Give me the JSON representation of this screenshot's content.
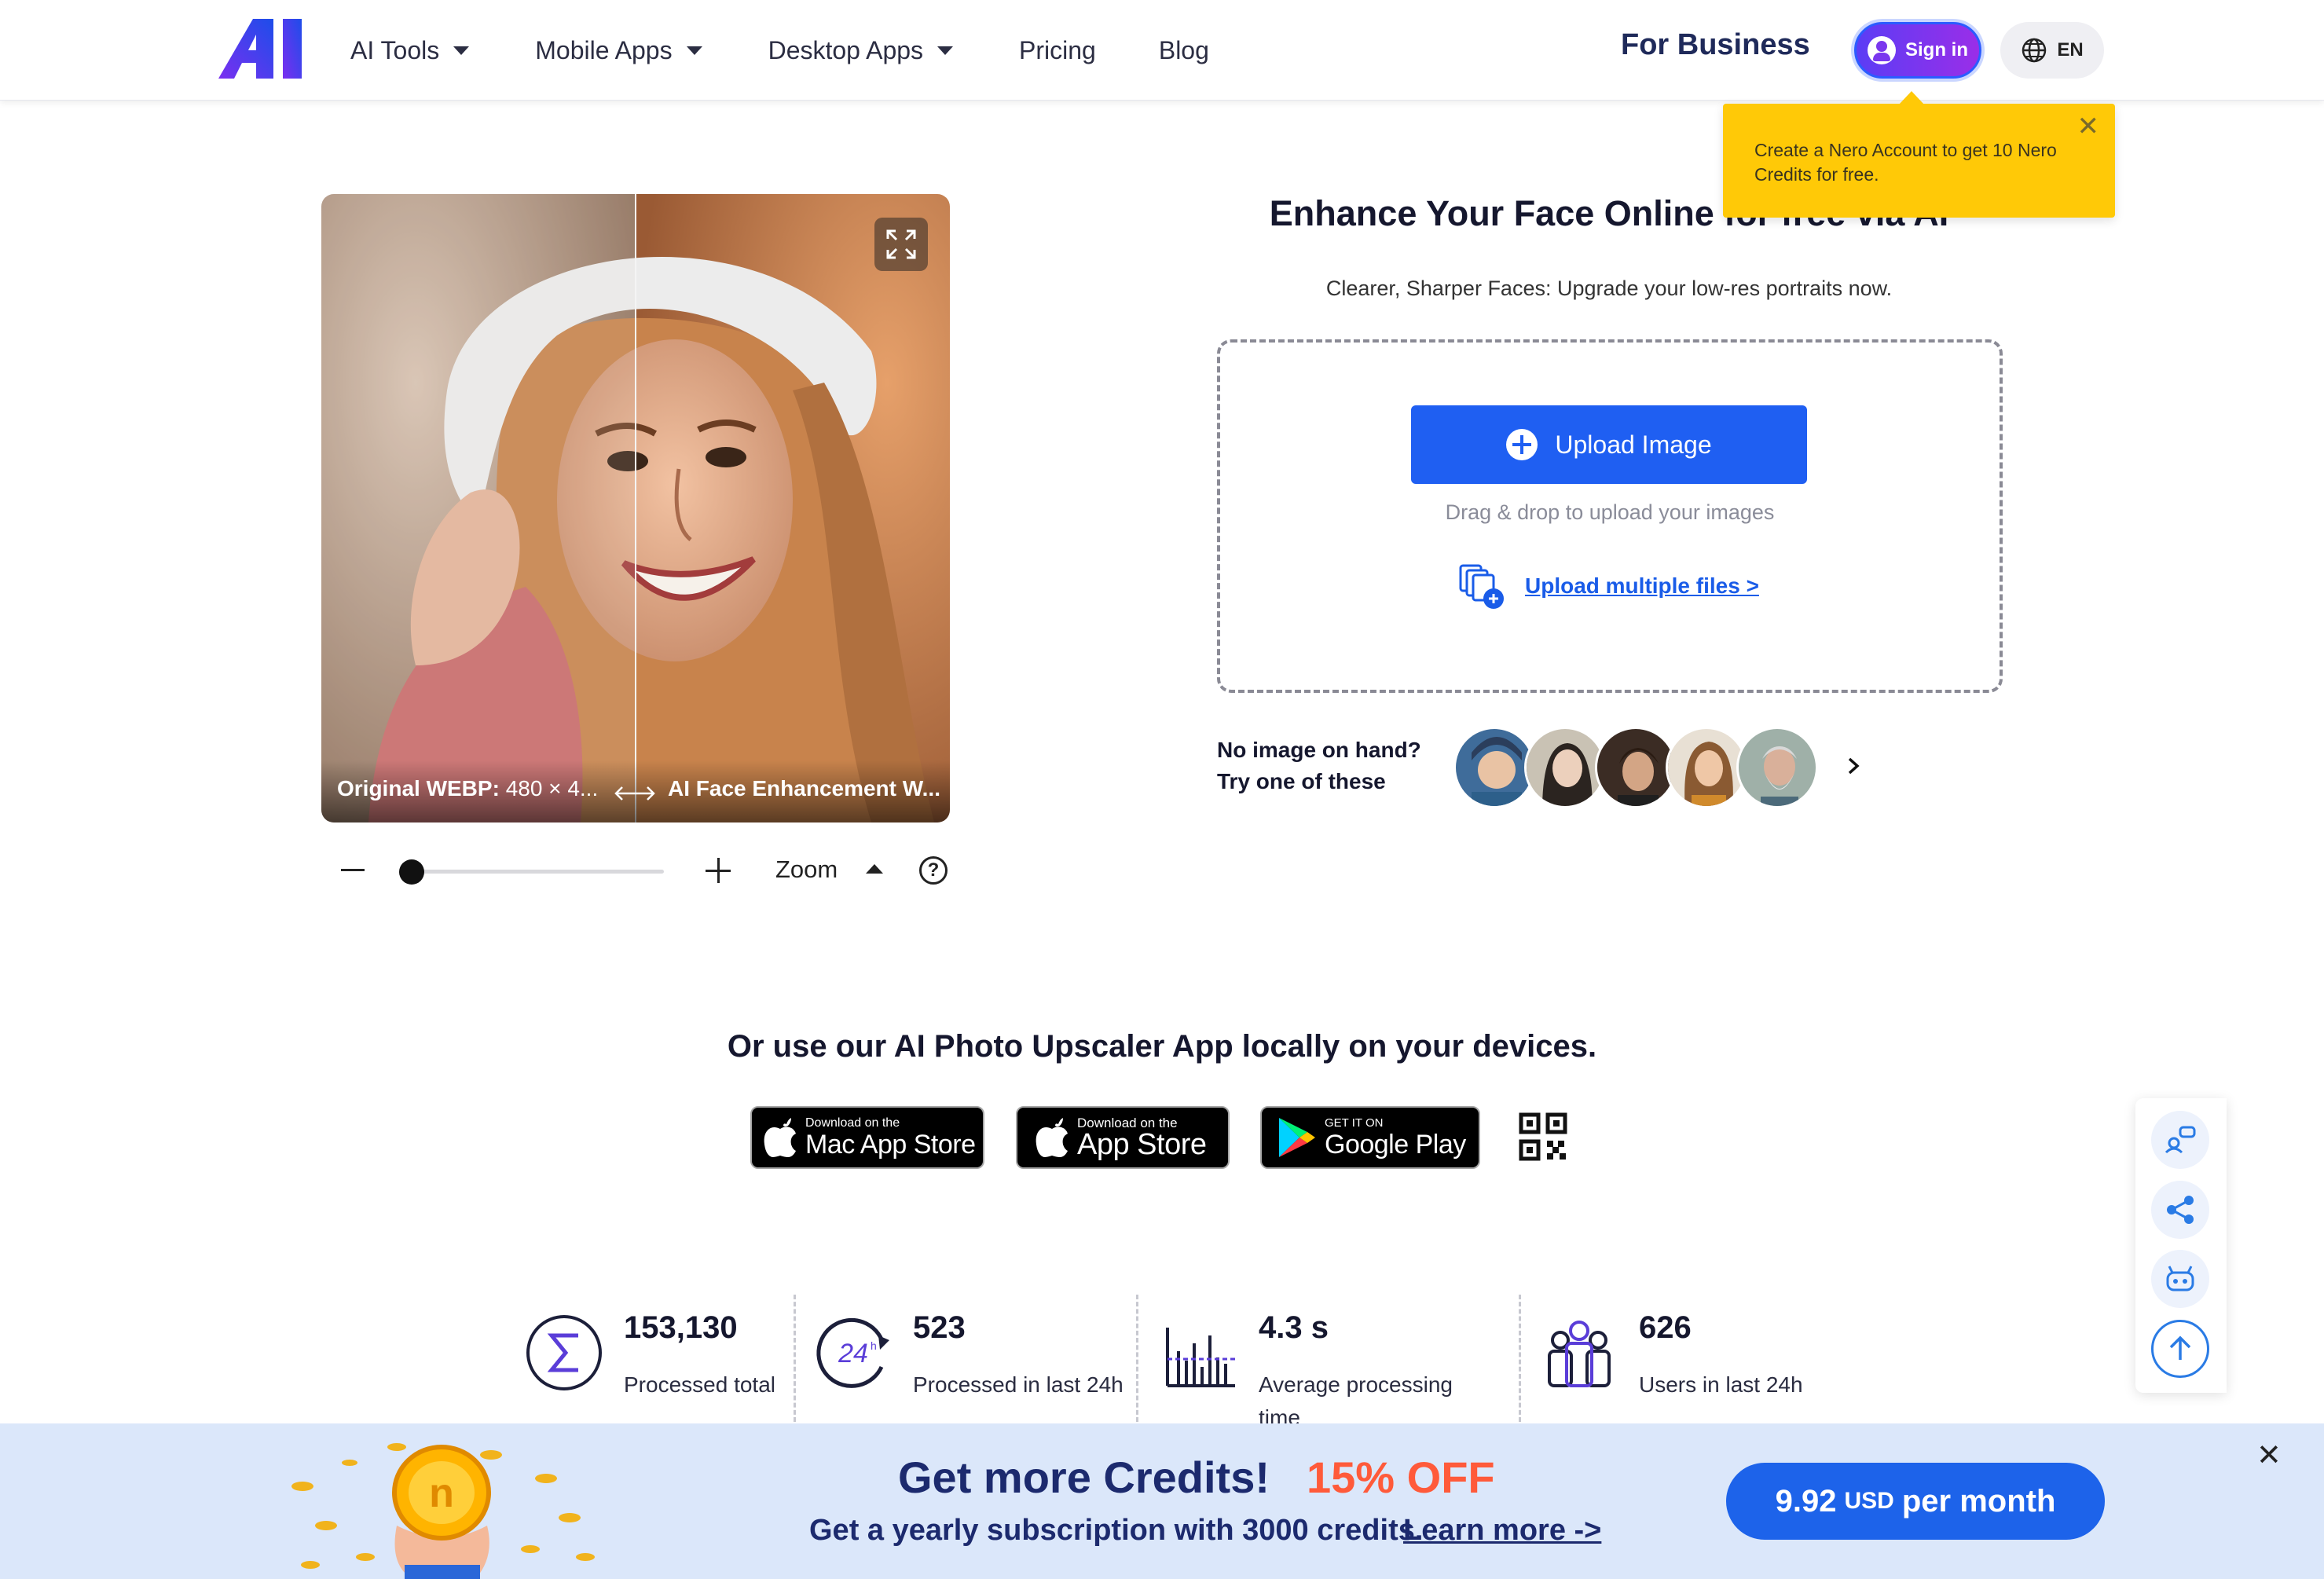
{
  "header": {
    "logo_text": "AI",
    "nav": [
      {
        "label": "AI Tools",
        "has_caret": true
      },
      {
        "label": "Mobile Apps",
        "has_caret": true
      },
      {
        "label": "Desktop Apps",
        "has_caret": true
      },
      {
        "label": "Pricing",
        "has_caret": false
      },
      {
        "label": "Blog",
        "has_caret": false
      }
    ],
    "for_business": "For Business",
    "sign_in": "Sign in",
    "language": "EN"
  },
  "tooltip": {
    "text": "Create a Nero Account to get 10 Nero Credits for free.",
    "close": "✕"
  },
  "compare": {
    "left_caption_label": "Original WEBP:",
    "left_caption_value": "480 × 4...",
    "right_caption": "AI Face Enhancement W..."
  },
  "zoom": {
    "label": "Zoom",
    "help": "?",
    "level": 0
  },
  "main": {
    "title": "Enhance Your Face Online for free via AI",
    "subtitle": "Clearer, Sharper Faces: Upgrade your low-res portraits now.",
    "upload_button": "Upload Image",
    "drag_hint": "Drag & drop to upload your images",
    "upload_multiple": "Upload multiple files >",
    "try_line1": "No image on hand?",
    "try_line2": "Try one of these"
  },
  "apps": {
    "title": "Or use our AI Photo Upscaler App locally on your devices.",
    "mac_small": "Download on the",
    "mac_big": "Mac App Store",
    "ios_small": "Download on the",
    "ios_big": "App Store",
    "play_small": "GET IT ON",
    "play_big": "Google Play"
  },
  "stats": [
    {
      "value": "153,130",
      "label": "Processed total",
      "icon": "sigma-icon"
    },
    {
      "value": "523",
      "label": "Processed in last 24h",
      "icon": "clock-24h-icon"
    },
    {
      "value": "4.3 s",
      "label": "Average processing time",
      "icon": "bar-chart-icon"
    },
    {
      "value": "626",
      "label": "Users in last 24h",
      "icon": "users-icon"
    }
  ],
  "side_tools": [
    "feedback-icon",
    "share-icon",
    "robot-icon",
    "scroll-top-icon"
  ],
  "promo": {
    "title": "Get more Credits!",
    "discount": "15% OFF",
    "subtitle": "Get a yearly subscription with 3000 credits.",
    "link": "Learn more ->",
    "price": "9.92",
    "currency": "USD",
    "period": "per month",
    "close": "✕"
  },
  "colors": {
    "primary_blue": "#1f5ff2",
    "signin_gradient_start": "#5b3df5",
    "signin_gradient_end": "#9a2ee8",
    "tooltip_yellow": "#ffc907",
    "promo_bg": "#dbe7fa",
    "discount_orange": "#ff5a3a"
  }
}
